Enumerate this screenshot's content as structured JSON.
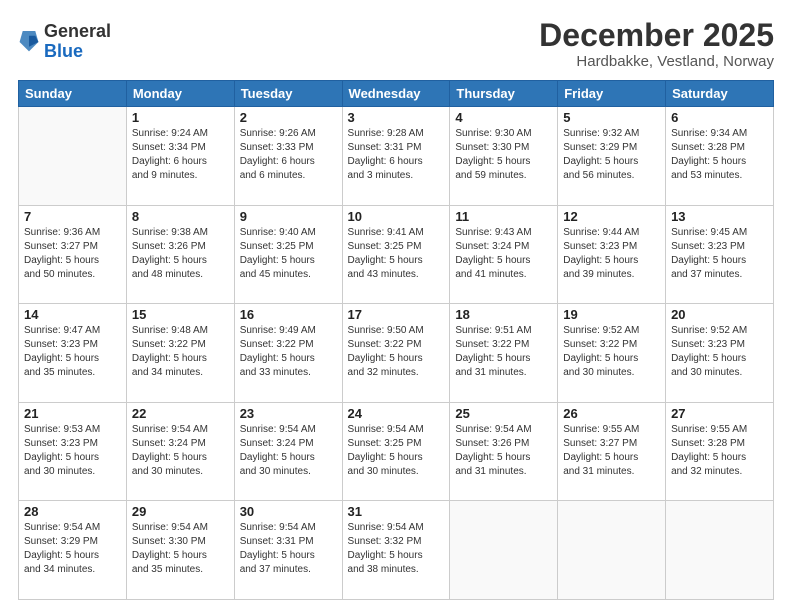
{
  "logo": {
    "general": "General",
    "blue": "Blue"
  },
  "title": "December 2025",
  "subtitle": "Hardbakke, Vestland, Norway",
  "days_of_week": [
    "Sunday",
    "Monday",
    "Tuesday",
    "Wednesday",
    "Thursday",
    "Friday",
    "Saturday"
  ],
  "weeks": [
    [
      {
        "day": "",
        "info": ""
      },
      {
        "day": "1",
        "info": "Sunrise: 9:24 AM\nSunset: 3:34 PM\nDaylight: 6 hours\nand 9 minutes."
      },
      {
        "day": "2",
        "info": "Sunrise: 9:26 AM\nSunset: 3:33 PM\nDaylight: 6 hours\nand 6 minutes."
      },
      {
        "day": "3",
        "info": "Sunrise: 9:28 AM\nSunset: 3:31 PM\nDaylight: 6 hours\nand 3 minutes."
      },
      {
        "day": "4",
        "info": "Sunrise: 9:30 AM\nSunset: 3:30 PM\nDaylight: 5 hours\nand 59 minutes."
      },
      {
        "day": "5",
        "info": "Sunrise: 9:32 AM\nSunset: 3:29 PM\nDaylight: 5 hours\nand 56 minutes."
      },
      {
        "day": "6",
        "info": "Sunrise: 9:34 AM\nSunset: 3:28 PM\nDaylight: 5 hours\nand 53 minutes."
      }
    ],
    [
      {
        "day": "7",
        "info": "Sunrise: 9:36 AM\nSunset: 3:27 PM\nDaylight: 5 hours\nand 50 minutes."
      },
      {
        "day": "8",
        "info": "Sunrise: 9:38 AM\nSunset: 3:26 PM\nDaylight: 5 hours\nand 48 minutes."
      },
      {
        "day": "9",
        "info": "Sunrise: 9:40 AM\nSunset: 3:25 PM\nDaylight: 5 hours\nand 45 minutes."
      },
      {
        "day": "10",
        "info": "Sunrise: 9:41 AM\nSunset: 3:25 PM\nDaylight: 5 hours\nand 43 minutes."
      },
      {
        "day": "11",
        "info": "Sunrise: 9:43 AM\nSunset: 3:24 PM\nDaylight: 5 hours\nand 41 minutes."
      },
      {
        "day": "12",
        "info": "Sunrise: 9:44 AM\nSunset: 3:23 PM\nDaylight: 5 hours\nand 39 minutes."
      },
      {
        "day": "13",
        "info": "Sunrise: 9:45 AM\nSunset: 3:23 PM\nDaylight: 5 hours\nand 37 minutes."
      }
    ],
    [
      {
        "day": "14",
        "info": "Sunrise: 9:47 AM\nSunset: 3:23 PM\nDaylight: 5 hours\nand 35 minutes."
      },
      {
        "day": "15",
        "info": "Sunrise: 9:48 AM\nSunset: 3:22 PM\nDaylight: 5 hours\nand 34 minutes."
      },
      {
        "day": "16",
        "info": "Sunrise: 9:49 AM\nSunset: 3:22 PM\nDaylight: 5 hours\nand 33 minutes."
      },
      {
        "day": "17",
        "info": "Sunrise: 9:50 AM\nSunset: 3:22 PM\nDaylight: 5 hours\nand 32 minutes."
      },
      {
        "day": "18",
        "info": "Sunrise: 9:51 AM\nSunset: 3:22 PM\nDaylight: 5 hours\nand 31 minutes."
      },
      {
        "day": "19",
        "info": "Sunrise: 9:52 AM\nSunset: 3:22 PM\nDaylight: 5 hours\nand 30 minutes."
      },
      {
        "day": "20",
        "info": "Sunrise: 9:52 AM\nSunset: 3:23 PM\nDaylight: 5 hours\nand 30 minutes."
      }
    ],
    [
      {
        "day": "21",
        "info": "Sunrise: 9:53 AM\nSunset: 3:23 PM\nDaylight: 5 hours\nand 30 minutes."
      },
      {
        "day": "22",
        "info": "Sunrise: 9:54 AM\nSunset: 3:24 PM\nDaylight: 5 hours\nand 30 minutes."
      },
      {
        "day": "23",
        "info": "Sunrise: 9:54 AM\nSunset: 3:24 PM\nDaylight: 5 hours\nand 30 minutes."
      },
      {
        "day": "24",
        "info": "Sunrise: 9:54 AM\nSunset: 3:25 PM\nDaylight: 5 hours\nand 30 minutes."
      },
      {
        "day": "25",
        "info": "Sunrise: 9:54 AM\nSunset: 3:26 PM\nDaylight: 5 hours\nand 31 minutes."
      },
      {
        "day": "26",
        "info": "Sunrise: 9:55 AM\nSunset: 3:27 PM\nDaylight: 5 hours\nand 31 minutes."
      },
      {
        "day": "27",
        "info": "Sunrise: 9:55 AM\nSunset: 3:28 PM\nDaylight: 5 hours\nand 32 minutes."
      }
    ],
    [
      {
        "day": "28",
        "info": "Sunrise: 9:54 AM\nSunset: 3:29 PM\nDaylight: 5 hours\nand 34 minutes."
      },
      {
        "day": "29",
        "info": "Sunrise: 9:54 AM\nSunset: 3:30 PM\nDaylight: 5 hours\nand 35 minutes."
      },
      {
        "day": "30",
        "info": "Sunrise: 9:54 AM\nSunset: 3:31 PM\nDaylight: 5 hours\nand 37 minutes."
      },
      {
        "day": "31",
        "info": "Sunrise: 9:54 AM\nSunset: 3:32 PM\nDaylight: 5 hours\nand 38 minutes."
      },
      {
        "day": "",
        "info": ""
      },
      {
        "day": "",
        "info": ""
      },
      {
        "day": "",
        "info": ""
      }
    ]
  ]
}
